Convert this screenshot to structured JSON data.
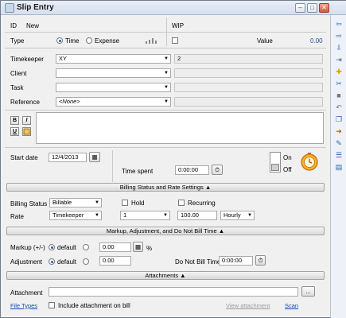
{
  "window": {
    "title": "Slip Entry",
    "minimize": "‒",
    "maximize": "□",
    "close": "✕"
  },
  "header": {
    "id_label": "ID",
    "id_value": "New",
    "wip_label": "WIP"
  },
  "type_row": {
    "label": "Type",
    "options": [
      "Time",
      "Expense"
    ],
    "selected": "Time",
    "value_label": "Value",
    "value": "0.00"
  },
  "fields": {
    "timekeeper": {
      "label": "Timekeeper",
      "value": "XY",
      "ref": "2"
    },
    "client": {
      "label": "Client",
      "value": ""
    },
    "task": {
      "label": "Task",
      "value": ""
    },
    "reference": {
      "label": "Reference",
      "value": "<None>"
    }
  },
  "format": {
    "bold": "B",
    "italic": "I",
    "underline": "U"
  },
  "dates": {
    "start_label": "Start date",
    "start_value": "12/4/2013",
    "time_spent_label": "Time spent",
    "time_spent_value": "0:00:00",
    "on_label": "On",
    "off_label": "Off"
  },
  "sections": {
    "billing": "Billing Status and Rate Settings",
    "markup": "Markup, Adjustment, and Do Not Bill Time",
    "attachments": "Attachments"
  },
  "billing": {
    "status_label": "Billing Status",
    "status_value": "Billable",
    "hold_label": "Hold",
    "recurring_label": "Recurring",
    "rate_label": "Rate",
    "rate_source": "Timekeeper",
    "rate_level": "1",
    "rate_amount": "100.00",
    "rate_unit": "Hourly"
  },
  "markup": {
    "markup_label": "Markup (+/-)",
    "default_label": "default",
    "markup_value": "0.00",
    "percent": "%",
    "adjustment_label": "Adjustment",
    "adjustment_value": "0.00",
    "dnb_label": "Do Not Bill Time",
    "dnb_value": "0:00:00"
  },
  "attachments": {
    "label": "Attachment",
    "browse": "...",
    "file_types": "File Types",
    "include_label": "Include attachment on bill",
    "view": "View attachment",
    "scan": "Scan"
  },
  "sidebar_icons": [
    "back-arrow-icon",
    "forward-arrow-icon",
    "next-arrow-icon",
    "last-arrow-icon",
    "new-slip-icon",
    "split-icon",
    "stop-icon",
    "undo-icon",
    "copy-icon",
    "save-icon",
    "edit-icon",
    "list-icon"
  ]
}
